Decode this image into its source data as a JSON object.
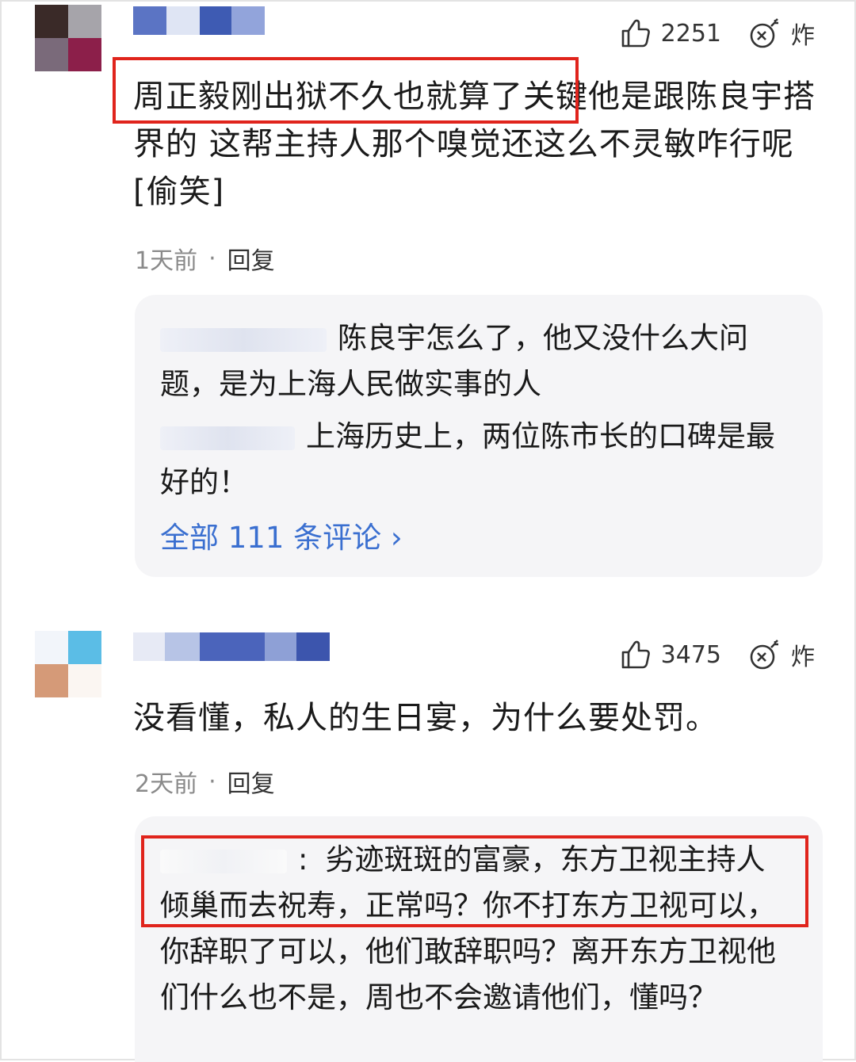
{
  "comments": [
    {
      "likes": "2251",
      "bomb_label": "炸",
      "text": "周正毅刚出狱不久也就算了关键他是跟陈良宇搭界的 这帮主持人那个嗅觉还这么不灵敏咋行呢[偷笑]",
      "time": "1天前",
      "separator": "·",
      "reply_label": "回复",
      "replies": [
        {
          "text": "陈良宇怎么了，他又没什么大问题，是为上海人民做实事的人"
        },
        {
          "text": "上海历史上，两位陈市长的口碑是最好的！"
        }
      ],
      "more_link": "全部 111 条评论 ›"
    },
    {
      "likes": "3475",
      "bomb_label": "炸",
      "text": "没看懂，私人的生日宴，为什么要处罚。",
      "time": "2天前",
      "separator": "·",
      "reply_label": "回复",
      "replies": [
        {
          "colon": ":",
          "text": "劣迹斑斑的富豪，东方卫视主持人倾巢而去祝寿，正常吗？你不打东方卫视可以，你辞职了可以，他们敢辞职吗？离开东方卫视他们什么也不是，周也不会邀请他们，懂吗？"
        }
      ]
    }
  ],
  "colors": {
    "highlight_border": "#e0241c",
    "link": "#3a6fd0",
    "reply_bg": "#f5f5f7"
  },
  "icons": [
    "thumbs-up-icon",
    "bomb-icon"
  ]
}
